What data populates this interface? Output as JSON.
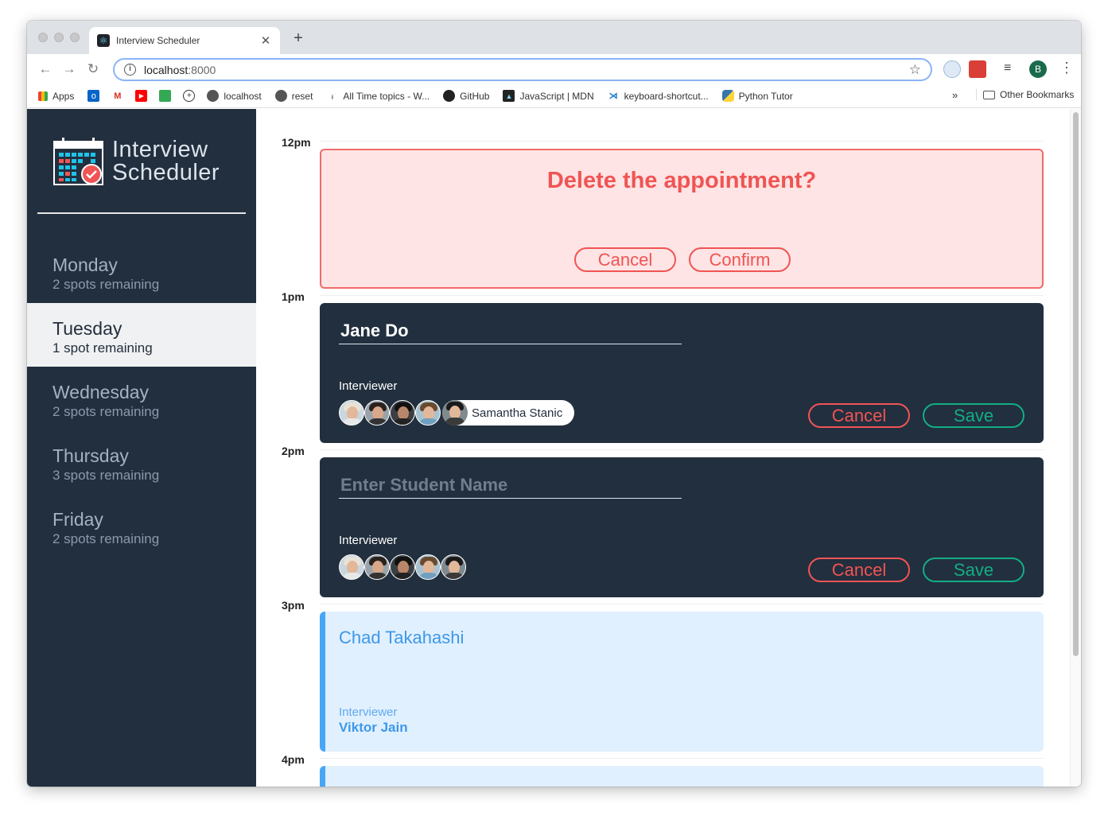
{
  "browser": {
    "tab_title": "Interview Scheduler",
    "url_host": "localhost",
    "url_port": ":8000",
    "avatar_letter": "B",
    "bookmarks": [
      "Apps",
      "localhost",
      "reset",
      "All Time topics - W...",
      "GitHub",
      "JavaScript | MDN",
      "keyboard-shortcut...",
      "Python Tutor"
    ],
    "more": "»",
    "other_bookmarks": "Other Bookmarks"
  },
  "sidebar": {
    "logo_line1": "Interview",
    "logo_line2": "Scheduler",
    "days": [
      {
        "name": "Monday",
        "spots": "2 spots remaining"
      },
      {
        "name": "Tuesday",
        "spots": "1 spot remaining"
      },
      {
        "name": "Wednesday",
        "spots": "2 spots remaining"
      },
      {
        "name": "Thursday",
        "spots": "3 spots remaining"
      },
      {
        "name": "Friday",
        "spots": "2 spots remaining"
      }
    ],
    "selected_day": "Tuesday"
  },
  "schedule": {
    "times": [
      "12pm",
      "1pm",
      "2pm",
      "3pm",
      "4pm"
    ],
    "confirm": {
      "message": "Delete the appointment?",
      "cancel": "Cancel",
      "confirm": "Confirm"
    },
    "edit_form": {
      "student_name": "Jane Do",
      "interviewer_label": "Interviewer",
      "selected_interviewer": "Samantha Stanic",
      "cancel": "Cancel",
      "save": "Save"
    },
    "create_form": {
      "placeholder": "Enter Student Name",
      "interviewer_label": "Interviewer",
      "cancel": "Cancel",
      "save": "Save"
    },
    "show": {
      "student": "Chad Takahashi",
      "interviewer_label": "Interviewer",
      "interviewer": "Viktor Jain"
    }
  },
  "colors": {
    "sidebar_bg": "#222f3e",
    "danger": "#f05454",
    "success": "#13ad85",
    "show_accent": "#48a6f7"
  }
}
